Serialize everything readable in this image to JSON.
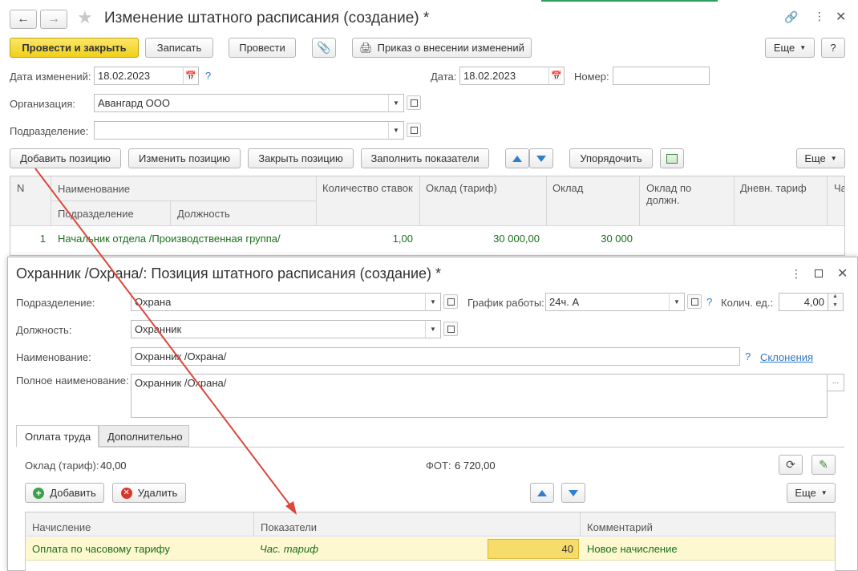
{
  "main": {
    "title": "Изменение штатного расписания (создание) *",
    "toolbar": {
      "post_close": "Провести и закрыть",
      "save": "Записать",
      "post": "Провести",
      "order": "Приказ о внесении изменений",
      "more": "Еще",
      "help": "?"
    },
    "fields": {
      "change_date_label": "Дата изменений:",
      "change_date": "18.02.2023",
      "date_label": "Дата:",
      "date": "18.02.2023",
      "number_label": "Номер:",
      "number": "",
      "org_label": "Организация:",
      "org": "Авангард ООО",
      "dept_label": "Подразделение:",
      "dept": ""
    },
    "table_toolbar": {
      "add": "Добавить позицию",
      "edit": "Изменить позицию",
      "close": "Закрыть позицию",
      "fill": "Заполнить показатели",
      "sort": "Упорядочить",
      "more": "Еще"
    },
    "table": {
      "headers": {
        "n": "N",
        "name": "Наименование",
        "dept": "Подразделение",
        "position": "Должность",
        "rates": "Количество ставок",
        "salary_tariff": "Оклад (тариф)",
        "salary": "Оклад",
        "salary_pos": "Оклад по должн.",
        "daily": "Дневн. тариф",
        "cut": "Ча"
      },
      "rows": [
        {
          "n": "1",
          "name": "Начальник отдела /Производственная группа/",
          "rates": "1,00",
          "salary_tariff": "30 000,00",
          "salary": "30 000"
        }
      ]
    }
  },
  "dialog": {
    "title": "Охранник /Охрана/: Позиция штатного расписания (создание) *",
    "dept_label": "Подразделение:",
    "dept": "Охрана",
    "schedule_label": "График работы:",
    "schedule": "24ч. А",
    "units_label": "Колич. ед.:",
    "units": "4,00",
    "position_label": "Должность:",
    "position": "Охранник",
    "name_label": "Наименование:",
    "name": "Охранник /Охрана/",
    "declension": "Склонения",
    "full_name_label": "Полное наименование:",
    "full_name": "Охранник /Охрана/",
    "tabs": [
      "Оплата труда",
      "Дополнительно"
    ],
    "salary_label": "Оклад (тариф):",
    "salary": "40,00",
    "fot_label": "ФОТ:",
    "fot": "6 720,00",
    "add": "Добавить",
    "delete": "Удалить",
    "more": "Еще",
    "grid": {
      "headers": {
        "accrual": "Начисление",
        "indicators": "Показатели",
        "comment": "Комментарий"
      },
      "rows": [
        {
          "accrual": "Оплата по часовому тарифу",
          "indicator": "Час. тариф",
          "value": "40",
          "comment": "Новое начисление"
        }
      ]
    }
  },
  "colors": {
    "accent": "#f0cf1a",
    "arrow": "#d9493c",
    "selected_row": "#fdf8d0",
    "link": "#2f78c5"
  }
}
